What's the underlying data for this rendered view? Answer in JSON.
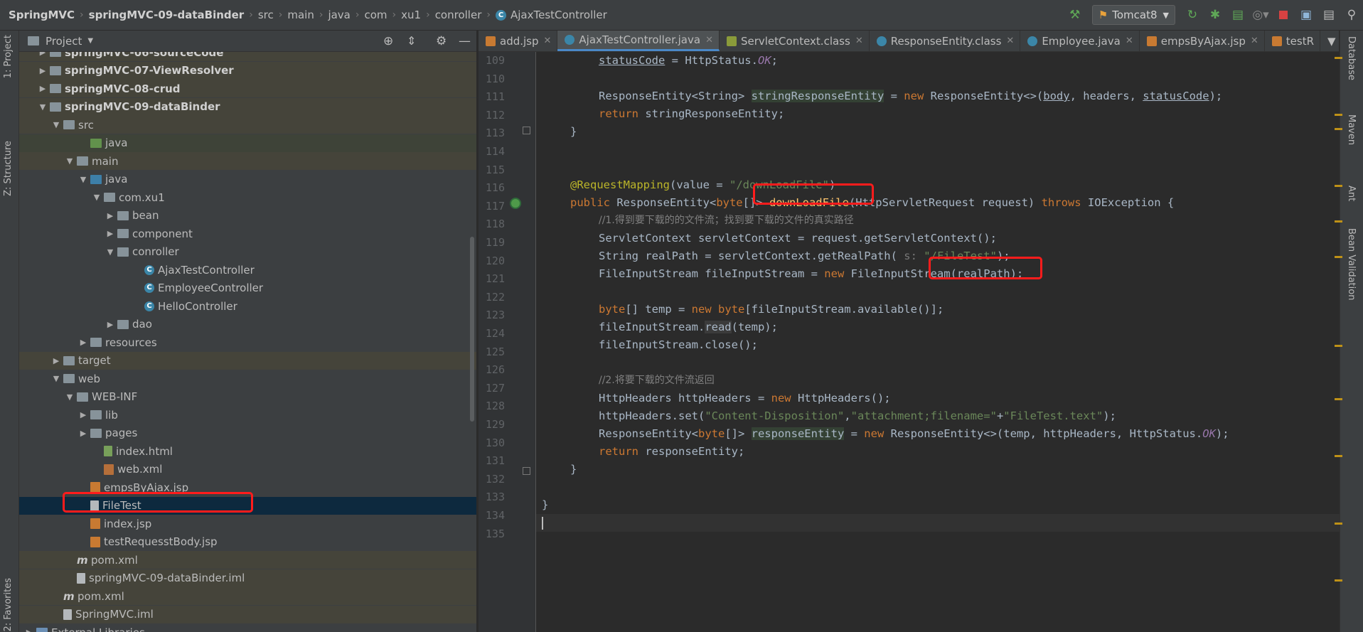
{
  "breadcrumb": [
    "SpringMVC",
    "springMVC-09-dataBinder",
    "src",
    "main",
    "java",
    "com",
    "xu1",
    "conroller",
    "AjaxTestController"
  ],
  "toolbar": {
    "run_config": "Tomcat8"
  },
  "left_stripe": {
    "project": "1: Project",
    "structure": "Z: Structure",
    "favorites": "2: Favorites"
  },
  "right_stripe": {
    "database": "Database",
    "maven": "Maven",
    "ant": "Ant",
    "bean": "Bean Validation"
  },
  "project_panel": {
    "title": "Project",
    "rows": [
      {
        "label": "springMVC-06-sourceCode"
      },
      {
        "label": "springMVC-07-ViewResolver"
      },
      {
        "label": "springMVC-08-crud"
      },
      {
        "label": "springMVC-09-dataBinder"
      },
      {
        "label": "src"
      },
      {
        "label": "java"
      },
      {
        "label": "main"
      },
      {
        "label": "java"
      },
      {
        "label": "com.xu1"
      },
      {
        "label": "bean"
      },
      {
        "label": "component"
      },
      {
        "label": "conroller"
      },
      {
        "label": "AjaxTestController"
      },
      {
        "label": "EmployeeController"
      },
      {
        "label": "HelloController"
      },
      {
        "label": "dao"
      },
      {
        "label": "resources"
      },
      {
        "label": "target"
      },
      {
        "label": "web"
      },
      {
        "label": "WEB-INF"
      },
      {
        "label": "lib"
      },
      {
        "label": "pages"
      },
      {
        "label": "index.html"
      },
      {
        "label": "web.xml"
      },
      {
        "label": "empsByAjax.jsp"
      },
      {
        "label": "FileTest"
      },
      {
        "label": "index.jsp"
      },
      {
        "label": "testRequesstBody.jsp"
      },
      {
        "label": "pom.xml"
      },
      {
        "label": "springMVC-09-dataBinder.iml"
      },
      {
        "label": "pom.xml"
      },
      {
        "label": "SpringMVC.iml"
      },
      {
        "label": "External Libraries"
      }
    ]
  },
  "tabs": [
    "add.jsp",
    "AjaxTestController.java",
    "ServletContext.class",
    "ResponseEntity.class",
    "Employee.java",
    "empsByAjax.jsp",
    "testR"
  ],
  "editor": {
    "line_numbers": [
      "109",
      "110",
      "111",
      "112",
      "113",
      "114",
      "115",
      "116",
      "117",
      "118",
      "119",
      "120",
      "121",
      "122",
      "123",
      "124",
      "125",
      "126",
      "127",
      "128",
      "129",
      "130",
      "131",
      "132",
      "133",
      "134",
      "135"
    ]
  },
  "colors": {
    "accent": "#4a88c7",
    "highlight_box": "#ff1c1c",
    "selection": "#0d293e",
    "keyword": "#cc7832",
    "string": "#6a8759",
    "annotation": "#bbb529"
  }
}
